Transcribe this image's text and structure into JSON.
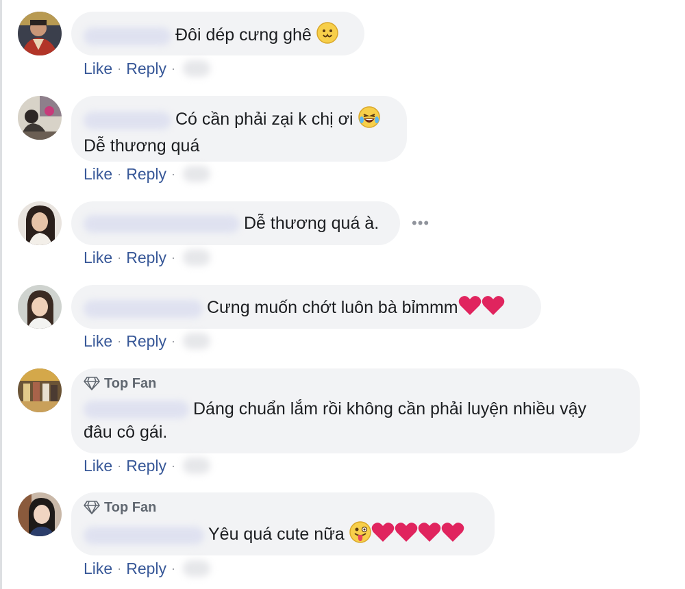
{
  "actions": {
    "like": "Like",
    "reply": "Reply",
    "separator": "·"
  },
  "comments": [
    {
      "lines": [
        "Đôi dép cưng ghê"
      ],
      "emoji": [
        "smile-face-icon"
      ]
    },
    {
      "lines": [
        "Có cần phải zại k chị ơi",
        "Dễ thương quá"
      ],
      "emoji": [
        "laughing-tears-face-icon"
      ]
    },
    {
      "lines": [
        "Dễ thương quá à."
      ],
      "emoji": []
    },
    {
      "lines": [
        "Cưng muốn chớt luôn bà bỉmmm"
      ],
      "emoji": [
        "heart-icon",
        "heart-icon"
      ]
    },
    {
      "badge": "Top Fan",
      "badge_icon": "diamond-icon",
      "lines": [
        "Dáng chuẩn lắm rồi không cần phải luyện nhiều vậy",
        "đâu cô gái."
      ],
      "emoji": []
    },
    {
      "badge": "Top Fan",
      "badge_icon": "diamond-icon",
      "lines": [
        "Yêu quá cute nữa"
      ],
      "emoji": [
        "tongue-face-icon",
        "heart-icon",
        "heart-icon",
        "heart-icon",
        "heart-icon"
      ]
    }
  ],
  "colors": {
    "bubble_bg": "#f2f3f5",
    "link": "#385898",
    "meta_gray": "#606770",
    "heart": "#e0245e"
  }
}
